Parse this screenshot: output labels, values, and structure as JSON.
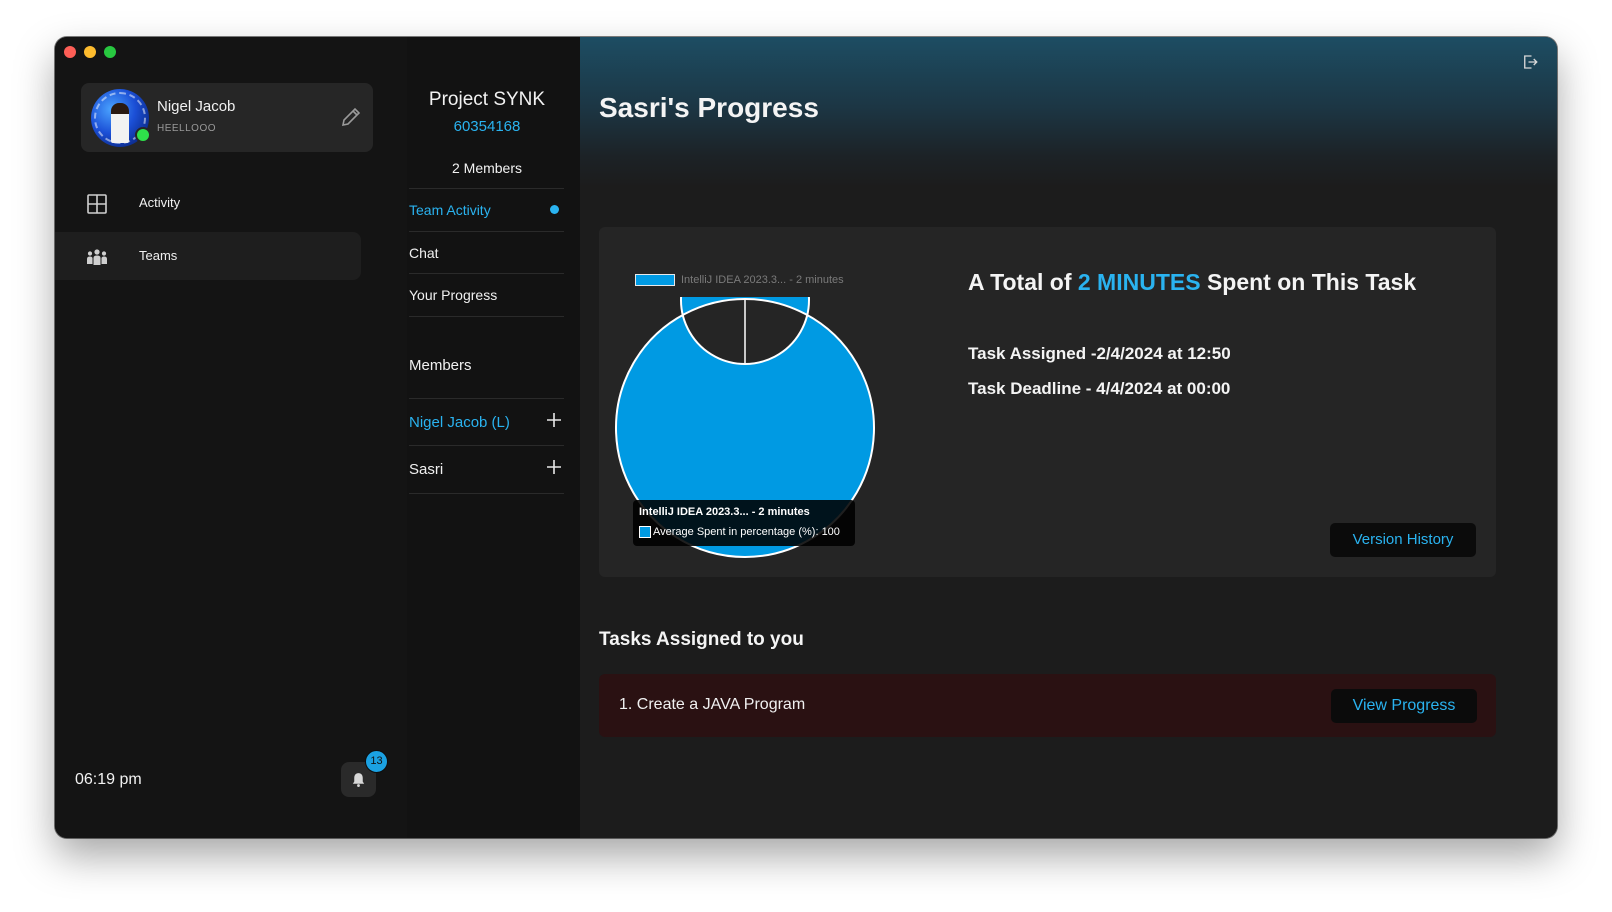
{
  "window": {
    "colors": {
      "accent": "#2ab3f0",
      "chart_fill": "#009ae3",
      "task_bg": "#2a1112"
    }
  },
  "profile": {
    "name": "Nigel Jacob",
    "status": "HEELLOOO",
    "online": true
  },
  "sidebar": {
    "items": [
      {
        "label": "Activity",
        "icon": "grid-icon"
      },
      {
        "label": "Teams",
        "icon": "people-icon"
      }
    ],
    "time": "06:19 pm",
    "notification_count": "13"
  },
  "project": {
    "title": "Project SYNK",
    "id": "60354168",
    "members_count": "2 Members",
    "menu": [
      {
        "label": "Team Activity"
      },
      {
        "label": "Chat"
      },
      {
        "label": "Your Progress"
      }
    ],
    "members_header": "Members",
    "members": [
      {
        "label": "Nigel Jacob (L)"
      },
      {
        "label": "Sasri"
      }
    ]
  },
  "main": {
    "title": "Sasri's Progress",
    "total": {
      "prefix": "A Total of ",
      "highlight": "2 MINUTES",
      "suffix": " Spent on This Task"
    },
    "task_assigned": "Task Assigned -2/4/2024 at 12:50",
    "task_deadline": "Task Deadline - 4/4/2024 at 00:00",
    "version_history": "Version History",
    "tasks_title": "Tasks Assigned to you",
    "tasks": [
      {
        "label": "1. Create a JAVA Program",
        "action": "View Progress"
      }
    ]
  },
  "chart_data": {
    "type": "pie",
    "legend": [
      "IntelliJ IDEA 2023.3... - 2 minutes"
    ],
    "categories": [
      "IntelliJ IDEA 2023.3... - 2 minutes"
    ],
    "values": [
      100
    ],
    "tooltip": {
      "title": "IntelliJ IDEA 2023.3... - 2 minutes",
      "row": "Average Spent in percentage (%): 100"
    }
  }
}
